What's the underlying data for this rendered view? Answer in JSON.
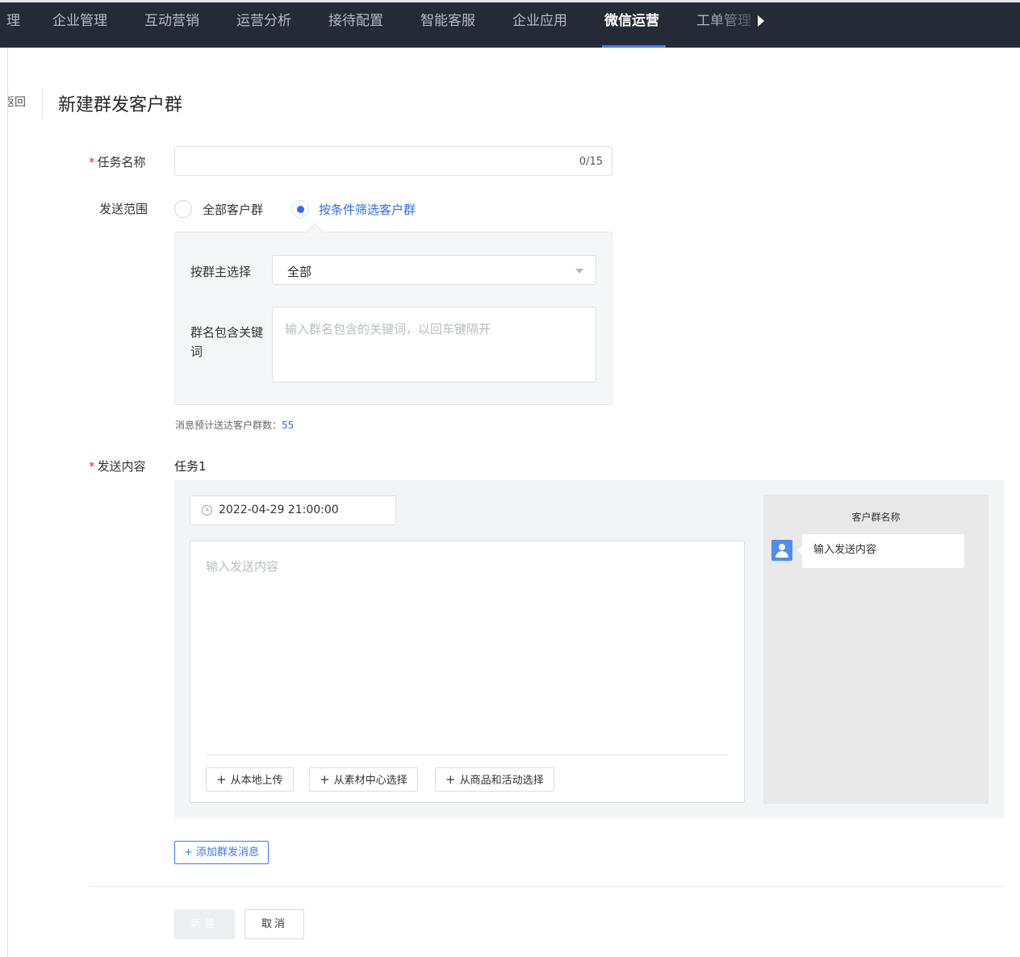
{
  "nav": {
    "items": [
      {
        "label": "理"
      },
      {
        "label": "企业管理"
      },
      {
        "label": "互动营销"
      },
      {
        "label": "运营分析"
      },
      {
        "label": "接待配置"
      },
      {
        "label": "智能客服"
      },
      {
        "label": "企业应用"
      },
      {
        "label": "微信运营",
        "active": true
      },
      {
        "label": "工单管理"
      }
    ],
    "more_icon": "caret-right-icon",
    "active_color": "#3d7df6",
    "background_color": "#252a37"
  },
  "header": {
    "back_label": "返回",
    "title": "新建群发客户群"
  },
  "form": {
    "task_name": {
      "label": "任务名称",
      "required_mark": "*",
      "value": "",
      "counter": "0/15"
    },
    "send_scope": {
      "label": "发送范围",
      "options": [
        {
          "label": "全部客户群",
          "checked": false
        },
        {
          "label": "按条件筛选客户群",
          "checked": true
        }
      ]
    },
    "filter": {
      "owner_label": "按群主选择",
      "owner_value": "全部",
      "keyword_label": "群名包含关键词",
      "keyword_placeholder": "输入群名包含的关键词，以回车键隔开"
    },
    "estimate": {
      "label": "消息预计送达客户群数：",
      "value": "55"
    },
    "send_content": {
      "label": "发送内容",
      "required_mark": "*",
      "task_title": "任务1",
      "datetime": "2022-04-29 21:00:00",
      "content_placeholder": "输入发送内容",
      "upload_buttons": [
        {
          "label": "从本地上传"
        },
        {
          "label": "从素材中心选择"
        },
        {
          "label": "从商品和活动选择"
        }
      ],
      "preview": {
        "title": "客户群名称",
        "bubble_text": "输入发送内容",
        "avatar_icon": "user-icon"
      }
    },
    "add_message_label": "添加群发消息",
    "plus_symbol": "+"
  },
  "actions": {
    "create_label": "新建",
    "cancel_label": "取消"
  },
  "colors": {
    "primary": "#2f6bf0",
    "required": "#f5222d",
    "link": "#3b78f0"
  }
}
